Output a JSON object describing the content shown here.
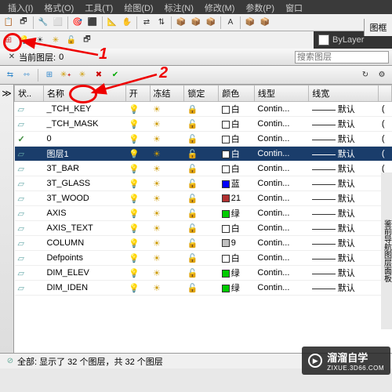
{
  "menu": {
    "items": [
      "插入(I)",
      "格式(O)",
      "工具(T)",
      "绘图(D)",
      "标注(N)",
      "修改(M)",
      "参数(P)",
      "窗口"
    ]
  },
  "right_label": "图框",
  "bylayer": {
    "label": "ByLayer"
  },
  "toolbar2": {
    "icons": [
      "🗗",
      "💡",
      "☀",
      "🔓",
      "🗗"
    ]
  },
  "title": {
    "prefix": "当前图层:",
    "value": "0",
    "search_placeholder": "搜索图层"
  },
  "toolbar3": {
    "icons": [
      "⇆",
      "⇿",
      "|",
      "⊞",
      "✳",
      "✳",
      "✖",
      "✔"
    ]
  },
  "columns": [
    "状..",
    "名称",
    "开",
    "冻结",
    "锁定",
    "颜色",
    "线型",
    "线宽",
    ""
  ],
  "sidebar_collapse": "≫",
  "layers": [
    {
      "status": "▱",
      "name": "_TCH_KEY",
      "on": "💡",
      "freeze": "☀",
      "lock": "🔒",
      "color_name": "白",
      "swatch": "#ffffff",
      "linetype": "Contin...",
      "lineweight": "默认",
      "sel": false
    },
    {
      "status": "▱",
      "name": "_TCH_MASK",
      "on": "💡",
      "freeze": "☀",
      "lock": "🔓",
      "color_name": "白",
      "swatch": "#ffffff",
      "linetype": "Contin...",
      "lineweight": "默认",
      "sel": false
    },
    {
      "status": "✓",
      "name": "0",
      "on": "💡",
      "freeze": "☀",
      "lock": "🔓",
      "color_name": "白",
      "swatch": "#ffffff",
      "linetype": "Contin...",
      "lineweight": "默认",
      "sel": false
    },
    {
      "status": "▱",
      "name": "图层1",
      "on": "💡",
      "freeze": "☀",
      "lock": "🔓",
      "color_name": "白",
      "swatch": "#ffffff",
      "linetype": "Contin...",
      "lineweight": "默认",
      "sel": true
    },
    {
      "status": "▱",
      "name": "3T_BAR",
      "on": "💡",
      "freeze": "☀",
      "lock": "🔓",
      "color_name": "白",
      "swatch": "#ffffff",
      "linetype": "Contin...",
      "lineweight": "默认",
      "sel": false
    },
    {
      "status": "▱",
      "name": "3T_GLASS",
      "on": "💡",
      "freeze": "☀",
      "lock": "🔓",
      "color_name": "蓝",
      "swatch": "#0000ff",
      "linetype": "Contin...",
      "lineweight": "默认",
      "sel": false
    },
    {
      "status": "▱",
      "name": "3T_WOOD",
      "on": "💡",
      "freeze": "☀",
      "lock": "🔓",
      "color_name": "21",
      "swatch": "#b03030",
      "linetype": "Contin...",
      "lineweight": "默认",
      "sel": false
    },
    {
      "status": "▱",
      "name": "AXIS",
      "on": "💡",
      "freeze": "☀",
      "lock": "🔓",
      "color_name": "绿",
      "swatch": "#00cc00",
      "linetype": "Contin...",
      "lineweight": "默认",
      "sel": false
    },
    {
      "status": "▱",
      "name": "AXIS_TEXT",
      "on": "💡",
      "freeze": "☀",
      "lock": "🔓",
      "color_name": "白",
      "swatch": "#ffffff",
      "linetype": "Contin...",
      "lineweight": "默认",
      "sel": false
    },
    {
      "status": "▱",
      "name": "COLUMN",
      "on": "💡",
      "freeze": "☀",
      "lock": "🔓",
      "color_name": "9",
      "swatch": "#c0c0c0",
      "linetype": "Contin...",
      "lineweight": "默认",
      "sel": false
    },
    {
      "status": "▱",
      "name": "Defpoints",
      "on": "💡",
      "freeze": "☀",
      "lock": "🔓",
      "color_name": "白",
      "swatch": "#ffffff",
      "linetype": "Contin...",
      "lineweight": "默认",
      "sel": false
    },
    {
      "status": "▱",
      "name": "DIM_ELEV",
      "on": "💡",
      "freeze": "☀",
      "lock": "🔓",
      "color_name": "绿",
      "swatch": "#00cc00",
      "linetype": "Contin...",
      "lineweight": "默认",
      "sel": false
    },
    {
      "status": "▱",
      "name": "DIM_IDEN",
      "on": "💡",
      "freeze": "☀",
      "lock": "🔓",
      "color_name": "绿",
      "swatch": "#00cc00",
      "linetype": "Contin...",
      "lineweight": "默认",
      "sel": false
    }
  ],
  "statusbar": {
    "text": "全部: 显示了 32 个图层，共 32 个图层"
  },
  "annotations": {
    "label1": "1",
    "label2": "2"
  },
  "right_strip": "鉴前导航图层面板",
  "watermark": {
    "text": "溜溜自学",
    "url": "ZIXUE.3D66.COM"
  }
}
